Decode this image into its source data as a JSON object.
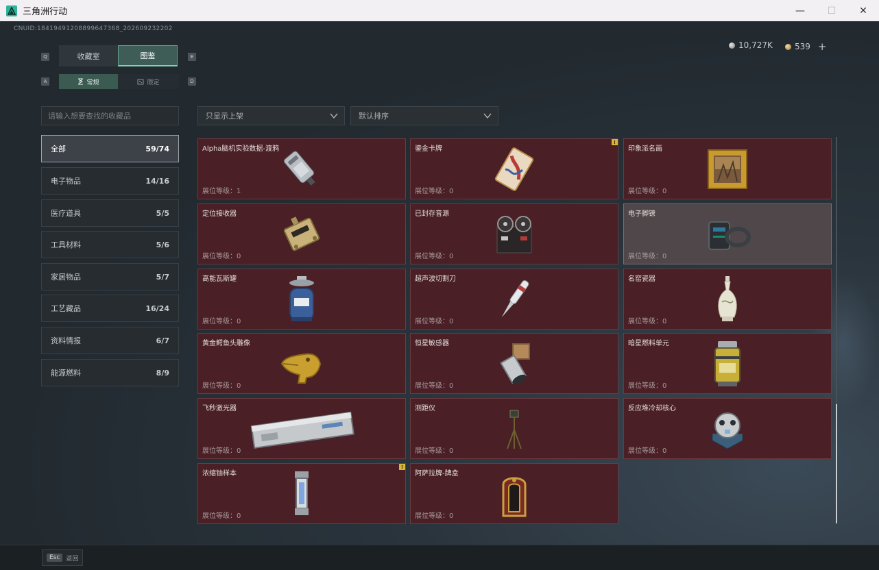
{
  "window": {
    "title": "三角洲行动"
  },
  "header": {
    "uid": "CNUID:18419491208899647368_202609232202",
    "silver": "10,727K",
    "gold": "539",
    "plus": "+"
  },
  "keys": {
    "q": "Q",
    "e": "E",
    "a": "A",
    "d": "D"
  },
  "tabs": {
    "collection": "收藏室",
    "catalog": "图鉴"
  },
  "subtabs": {
    "normal": "常规",
    "limited": "限定"
  },
  "search": {
    "placeholder": "请输入想要查找的收藏品"
  },
  "filters": {
    "shelf": "只显示上架",
    "sort": "默认排序"
  },
  "categories": [
    {
      "label": "全部",
      "count": "59/74"
    },
    {
      "label": "电子物品",
      "count": "14/16"
    },
    {
      "label": "医疗道具",
      "count": "5/5"
    },
    {
      "label": "工具材料",
      "count": "5/6"
    },
    {
      "label": "家居物品",
      "count": "5/7"
    },
    {
      "label": "工艺藏品",
      "count": "16/24"
    },
    {
      "label": "资料情报",
      "count": "6/7"
    },
    {
      "label": "能源燃料",
      "count": "8/9"
    }
  ],
  "items": [
    {
      "name": "Alpha脑机实验数据-渡鸦",
      "level": "展位等级：1",
      "icon": "data-drive-icon"
    },
    {
      "name": "鎏金卡牌",
      "level": "展位等级：0",
      "icon": "card-icon",
      "badge": "!"
    },
    {
      "name": "印象派名画",
      "level": "展位等级：0",
      "icon": "painting-icon"
    },
    {
      "name": "定位接收器",
      "level": "展位等级：0",
      "icon": "receiver-icon"
    },
    {
      "name": "已封存音源",
      "level": "展位等级：0",
      "icon": "tape-recorder-icon"
    },
    {
      "name": "电子脚镣",
      "level": "展位等级：0",
      "icon": "ankle-monitor-icon"
    },
    {
      "name": "高能瓦斯罐",
      "level": "展位等级：0",
      "icon": "gas-tank-icon"
    },
    {
      "name": "超声波切割刀",
      "level": "展位等级：0",
      "icon": "ultrasonic-knife-icon"
    },
    {
      "name": "名窑瓷器",
      "level": "展位等级：0",
      "icon": "porcelain-vase-icon"
    },
    {
      "name": "黄金鳄鱼头雕像",
      "level": "展位等级：0",
      "icon": "gold-crocodile-icon"
    },
    {
      "name": "恒星敏感器",
      "level": "展位等级：0",
      "icon": "star-sensor-icon"
    },
    {
      "name": "暗星燃料单元",
      "level": "展位等级：0",
      "icon": "fuel-cell-icon"
    },
    {
      "name": "飞秒激光器",
      "level": "展位等级：0",
      "icon": "laser-icon"
    },
    {
      "name": "测距仪",
      "level": "展位等级：0",
      "icon": "rangefinder-icon"
    },
    {
      "name": "反应堆冷却核心",
      "level": "展位等级：0",
      "icon": "reactor-core-icon"
    },
    {
      "name": "浓缩铀样本",
      "level": "展位等级：0",
      "icon": "uranium-sample-icon",
      "badge": "!"
    },
    {
      "name": "阿萨拉牌-牌盒",
      "level": "展位等级：0",
      "icon": "card-box-icon"
    }
  ],
  "footer": {
    "esc_key": "Esc",
    "esc_label": "返回"
  },
  "colors": {
    "card_bg": "#4a1f25",
    "card_gray_bg": "#4f4749",
    "accent": "#3e5d56",
    "badge": "#d8b43a"
  }
}
